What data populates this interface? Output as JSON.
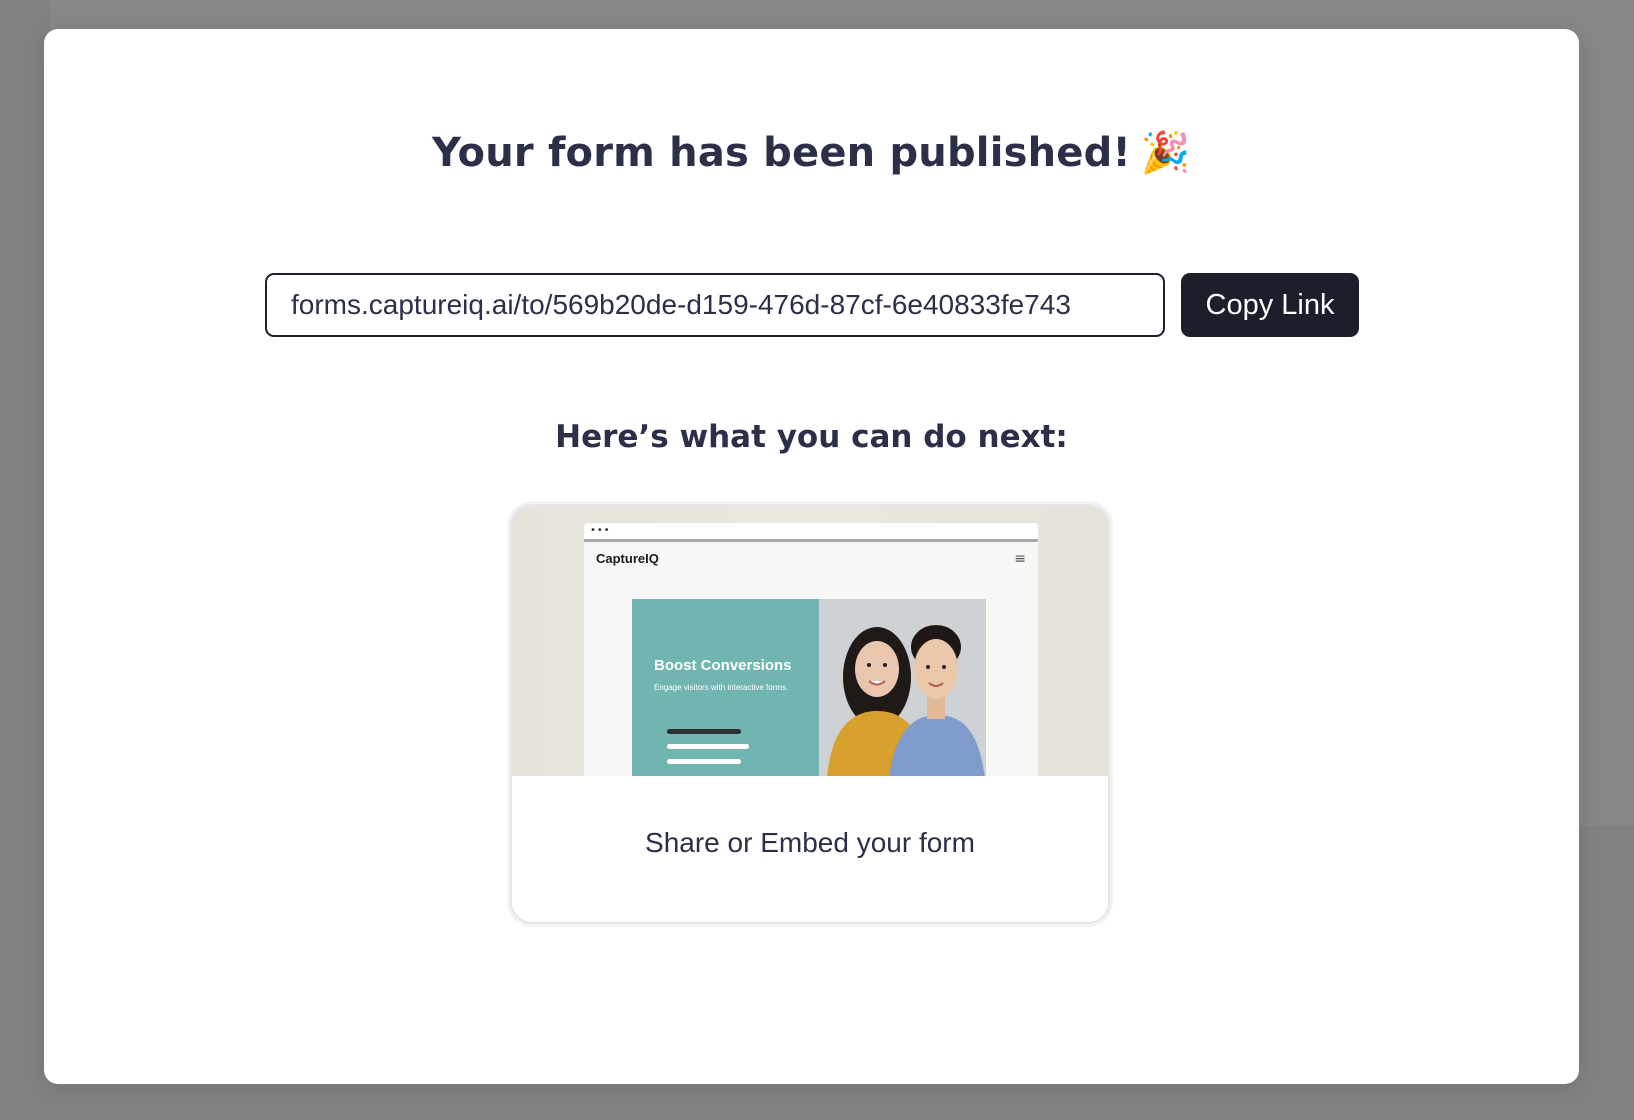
{
  "modal": {
    "title": "Your form has been published!",
    "title_emoji": "🎉",
    "link": {
      "value": "forms.captureiq.ai/to/569b20de-d159-476d-87cf-6e40833fe743",
      "copy_label": "Copy Link"
    },
    "next_heading": "Here’s what you can do next:",
    "cards": [
      {
        "label": "Share or Embed your form",
        "preview": {
          "browser_dots": "•••",
          "brand": "CaptureIQ",
          "menu_icon": "hamburger-icon",
          "headline": "Boost Conversions",
          "tagline": "Engage visitors with interactive forms."
        }
      }
    ]
  },
  "colors": {
    "backdrop": "#828282",
    "text_primary": "#2b3048",
    "button_bg": "#1c1e2c",
    "preview_teal": "#71b5b1"
  }
}
